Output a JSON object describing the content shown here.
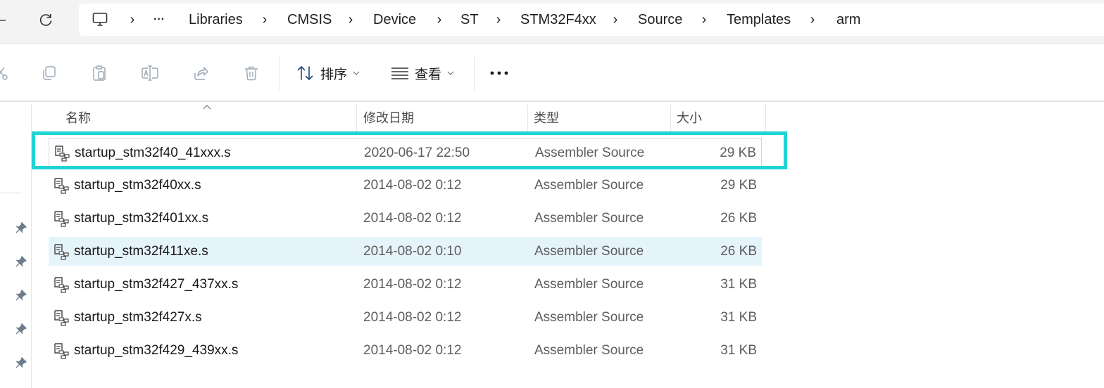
{
  "address_bar": {
    "overflow_label": "···",
    "separator": "›",
    "crumbs": [
      "Libraries",
      "CMSIS",
      "Device",
      "ST",
      "STM32F4xx",
      "Source",
      "Templates",
      "arm"
    ]
  },
  "toolbar": {
    "sort_label": "排序",
    "view_label": "查看",
    "more_label": "···",
    "icons": [
      "cut-icon",
      "copy-icon",
      "paste-icon",
      "rename-icon",
      "share-icon",
      "delete-icon"
    ]
  },
  "columns": {
    "name": "名称",
    "modified": "修改日期",
    "type": "类型",
    "size": "大小"
  },
  "files": [
    {
      "name": "startup_stm32f40_41xxx.s",
      "modified": "2020-06-17 22:50",
      "type": "Assembler Source",
      "size": "29 KB"
    },
    {
      "name": "startup_stm32f40xx.s",
      "modified": "2014-08-02 0:12",
      "type": "Assembler Source",
      "size": "29 KB"
    },
    {
      "name": "startup_stm32f401xx.s",
      "modified": "2014-08-02 0:12",
      "type": "Assembler Source",
      "size": "26 KB"
    },
    {
      "name": "startup_stm32f411xe.s",
      "modified": "2014-08-02 0:10",
      "type": "Assembler Source",
      "size": "26 KB"
    },
    {
      "name": "startup_stm32f427_437xx.s",
      "modified": "2014-08-02 0:12",
      "type": "Assembler Source",
      "size": "31 KB"
    },
    {
      "name": "startup_stm32f427x.s",
      "modified": "2014-08-02 0:12",
      "type": "Assembler Source",
      "size": "31 KB"
    },
    {
      "name": "startup_stm32f429_439xx.s",
      "modified": "2014-08-02 0:12",
      "type": "Assembler Source",
      "size": "31 KB"
    }
  ],
  "colors": {
    "highlight": "#22d3d3",
    "selected_row": "#e5f3fb"
  }
}
